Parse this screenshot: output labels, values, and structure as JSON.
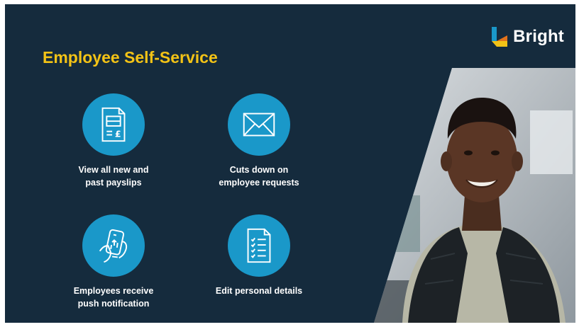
{
  "brand": {
    "name": "Bright"
  },
  "title": "Employee Self-Service",
  "features": [
    {
      "label": "View all new and\npast payslips",
      "icon": "payslip-icon"
    },
    {
      "label": "Cuts down on\nemployee requests",
      "icon": "envelope-icon"
    },
    {
      "label": "Employees receive\npush notification",
      "icon": "phone-notification-icon"
    },
    {
      "label": "Edit personal details",
      "icon": "checklist-document-icon"
    }
  ],
  "colors": {
    "background": "#152b3d",
    "title": "#f3c316",
    "icon_circle": "#1a98c9",
    "logo_blue": "#1a98c9",
    "logo_yellow": "#f3c316"
  }
}
